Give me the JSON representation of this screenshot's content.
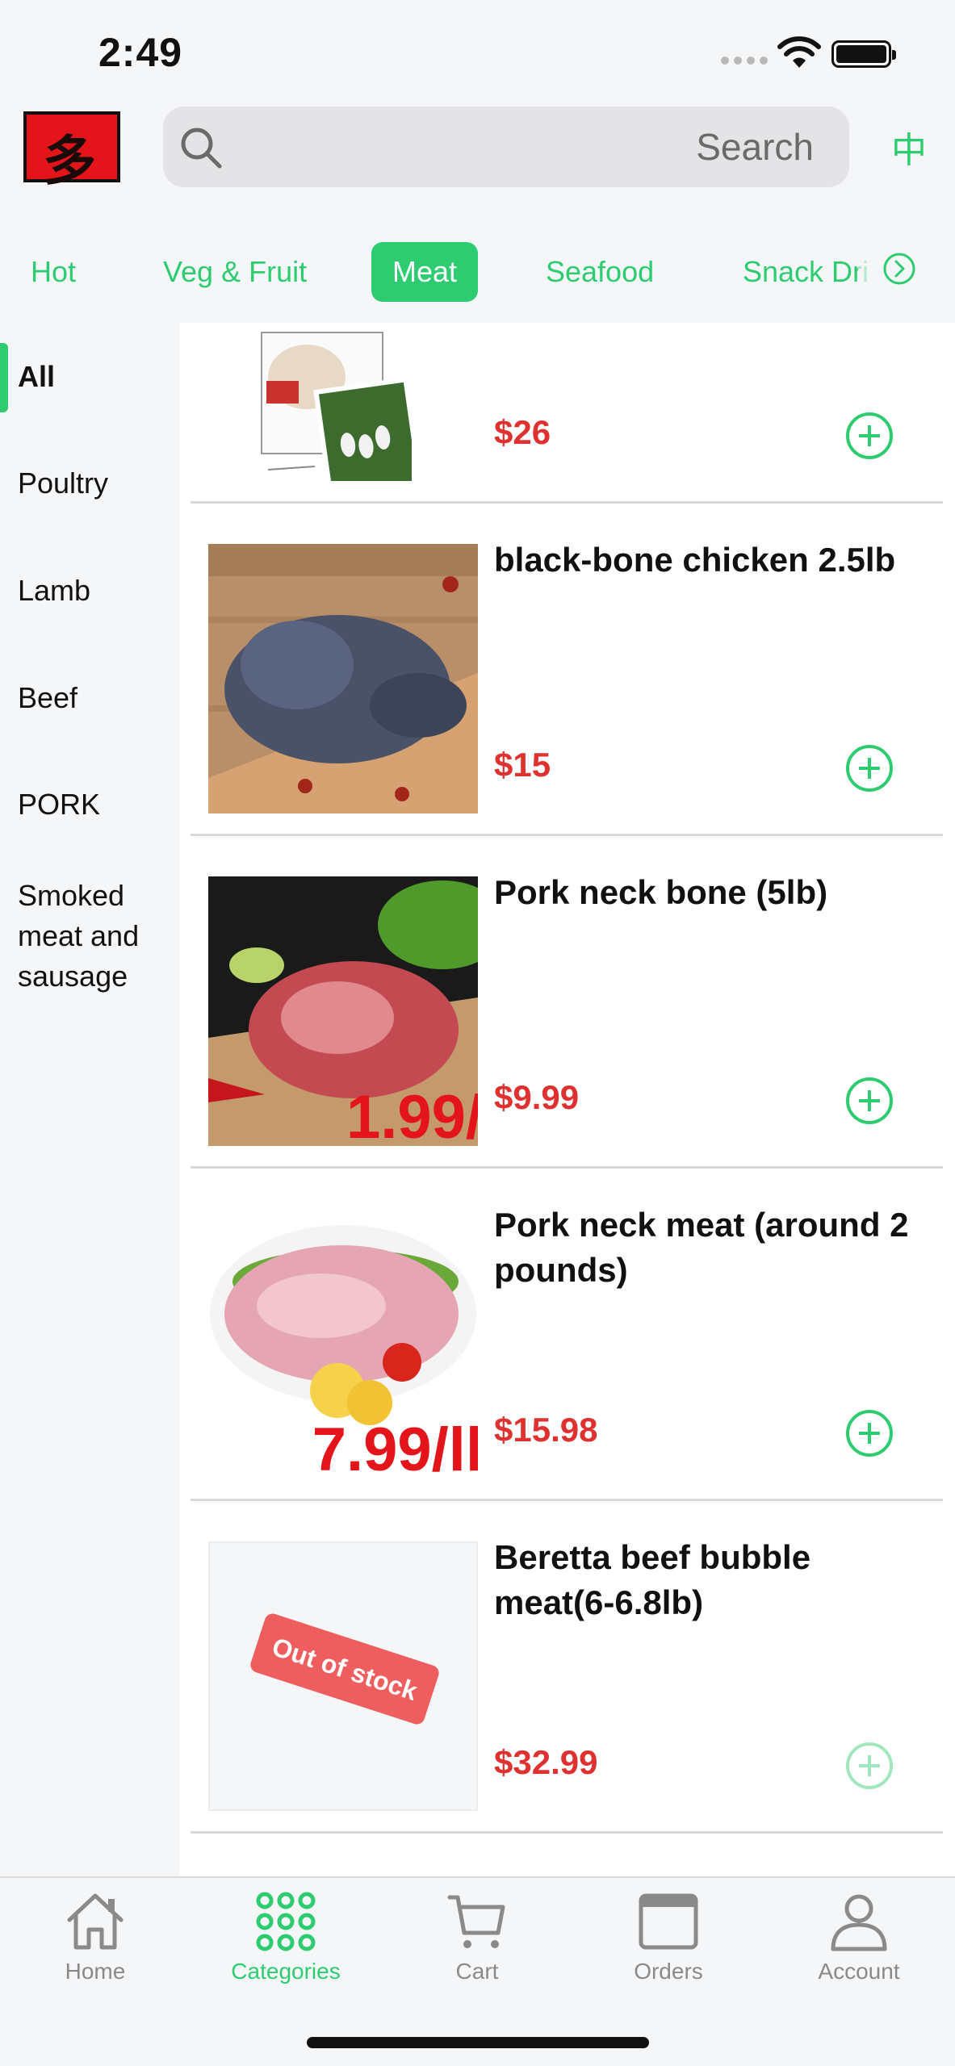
{
  "status": {
    "time": "2:49"
  },
  "header": {
    "search_placeholder": "Search",
    "lang_label": "中",
    "logo_glyph": "多"
  },
  "tabs": [
    {
      "label": "Hot",
      "active": false
    },
    {
      "label": "Veg & Fruit",
      "active": false
    },
    {
      "label": "Meat",
      "active": true
    },
    {
      "label": "Seafood",
      "active": false
    },
    {
      "label": "Snack Dri",
      "active": false
    }
  ],
  "sidebar": {
    "items": [
      {
        "label": "All",
        "active": true
      },
      {
        "label": "Poultry",
        "active": false
      },
      {
        "label": "Lamb",
        "active": false
      },
      {
        "label": "Beef",
        "active": false
      },
      {
        "label": "PORK",
        "active": false
      },
      {
        "label": "Smoked meat and sausage",
        "active": false
      }
    ]
  },
  "products": [
    {
      "name": "",
      "price": "$26",
      "image": "duck-photo",
      "in_stock": true
    },
    {
      "name": "black-bone chicken 2.5lb",
      "price": "$15",
      "image": "black-chicken-photo",
      "in_stock": true
    },
    {
      "name": "Pork neck bone (5lb)",
      "price": "$9.99",
      "image": "pork-neck-bone-photo",
      "image_overlay": "1.99/",
      "in_stock": true
    },
    {
      "name": "Pork neck meat (around 2 pounds)",
      "price": "$15.98",
      "image": "pork-neck-meat-photo",
      "image_overlay": "7.99/ll",
      "in_stock": true
    },
    {
      "name": "Beretta beef bubble meat(6-6.8lb)",
      "price": "$32.99",
      "image": "placeholder",
      "badge": "Out of stock",
      "in_stock": false
    }
  ],
  "tabbar": {
    "items": [
      {
        "label": "Home",
        "icon": "home-icon",
        "active": false
      },
      {
        "label": "Categories",
        "icon": "grid-icon",
        "active": true
      },
      {
        "label": "Cart",
        "icon": "cart-icon",
        "active": false
      },
      {
        "label": "Orders",
        "icon": "window-icon",
        "active": false
      },
      {
        "label": "Account",
        "icon": "person-icon",
        "active": false
      }
    ]
  },
  "colors": {
    "accent": "#2ecc71",
    "price": "#e03131",
    "out_of_stock": "#ef5e5e"
  }
}
